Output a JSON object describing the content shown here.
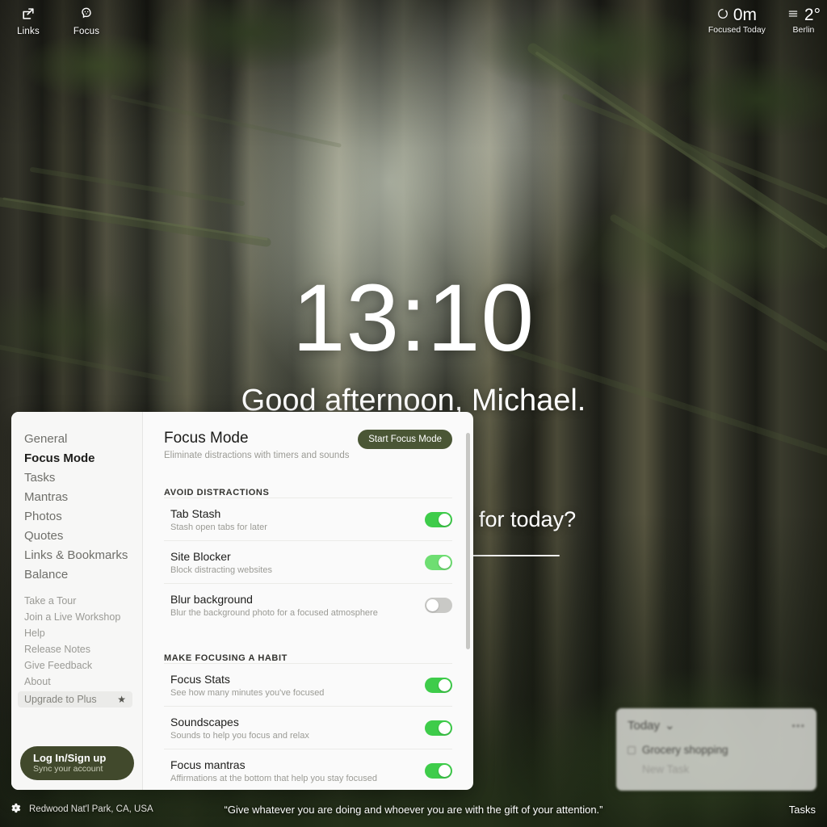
{
  "topbar": {
    "left_items": [
      {
        "label": "Links",
        "icon": "external-link-icon"
      },
      {
        "label": "Focus",
        "icon": "brain-icon"
      }
    ],
    "focus_stat": {
      "value": "0m",
      "label": "Focused Today",
      "icon": "timer-circle-icon"
    },
    "weather": {
      "value": "2°",
      "label": "Berlin",
      "icon": "fog-icon"
    }
  },
  "hero": {
    "clock": "13:10",
    "greeting": "Good afternoon, Michael.",
    "goal_question": "What is your main goal for today?"
  },
  "tasks_widget": {
    "title": "Today",
    "chevron": "⌄",
    "menu": "•••",
    "items": [
      {
        "label": "Grocery shopping",
        "done": false
      }
    ],
    "new_task_placeholder": "New Task"
  },
  "bottombar": {
    "settings_icon": "gear-icon",
    "location": "Redwood Nat'l Park, CA, USA",
    "quote": "“Give whatever you are doing and whoever you are with the gift of your attention.”",
    "tasks_label": "Tasks"
  },
  "settings": {
    "nav_primary": [
      {
        "label": "General",
        "active": false
      },
      {
        "label": "Focus Mode",
        "active": true
      },
      {
        "label": "Tasks",
        "active": false
      },
      {
        "label": "Mantras",
        "active": false
      },
      {
        "label": "Photos",
        "active": false
      },
      {
        "label": "Quotes",
        "active": false
      },
      {
        "label": "Links & Bookmarks",
        "active": false
      },
      {
        "label": "Balance",
        "active": false
      }
    ],
    "nav_secondary": [
      {
        "label": "Take a Tour"
      },
      {
        "label": "Join a Live Workshop"
      },
      {
        "label": "Help"
      },
      {
        "label": "Release Notes"
      },
      {
        "label": "Give Feedback"
      },
      {
        "label": "About"
      }
    ],
    "upgrade": {
      "label": "Upgrade to Plus",
      "icon": "star-icon",
      "star": "★"
    },
    "login": {
      "title": "Log In/Sign up",
      "subtitle": "Sync your account"
    },
    "panel": {
      "title": "Focus Mode",
      "subtitle": "Eliminate distractions with timers and sounds",
      "start_button": "Start Focus Mode",
      "sections": [
        {
          "heading": "AVOID DISTRACTIONS",
          "rows": [
            {
              "name": "Tab Stash",
              "desc": "Stash open tabs for later",
              "state": "on"
            },
            {
              "name": "Site Blocker",
              "desc": "Block distracting websites",
              "state": "on-pale"
            },
            {
              "name": "Blur background",
              "desc": "Blur the background photo for a focused atmosphere",
              "state": "off"
            }
          ]
        },
        {
          "heading": "MAKE FOCUSING A HABIT",
          "rows": [
            {
              "name": "Focus Stats",
              "desc": "See how many minutes you've focused",
              "state": "on"
            },
            {
              "name": "Soundscapes",
              "desc": "Sounds to help you focus and relax",
              "state": "on"
            },
            {
              "name": "Focus mantras",
              "desc": "Affirmations at the bottom that help you stay focused",
              "state": "on"
            }
          ]
        }
      ]
    }
  },
  "colors": {
    "accent_green": "#41492c",
    "start_button": "#4a5635",
    "toggle_on": "#3ecc4a",
    "toggle_off": "#c9c9c6",
    "panel_bg": "#fafafa"
  }
}
